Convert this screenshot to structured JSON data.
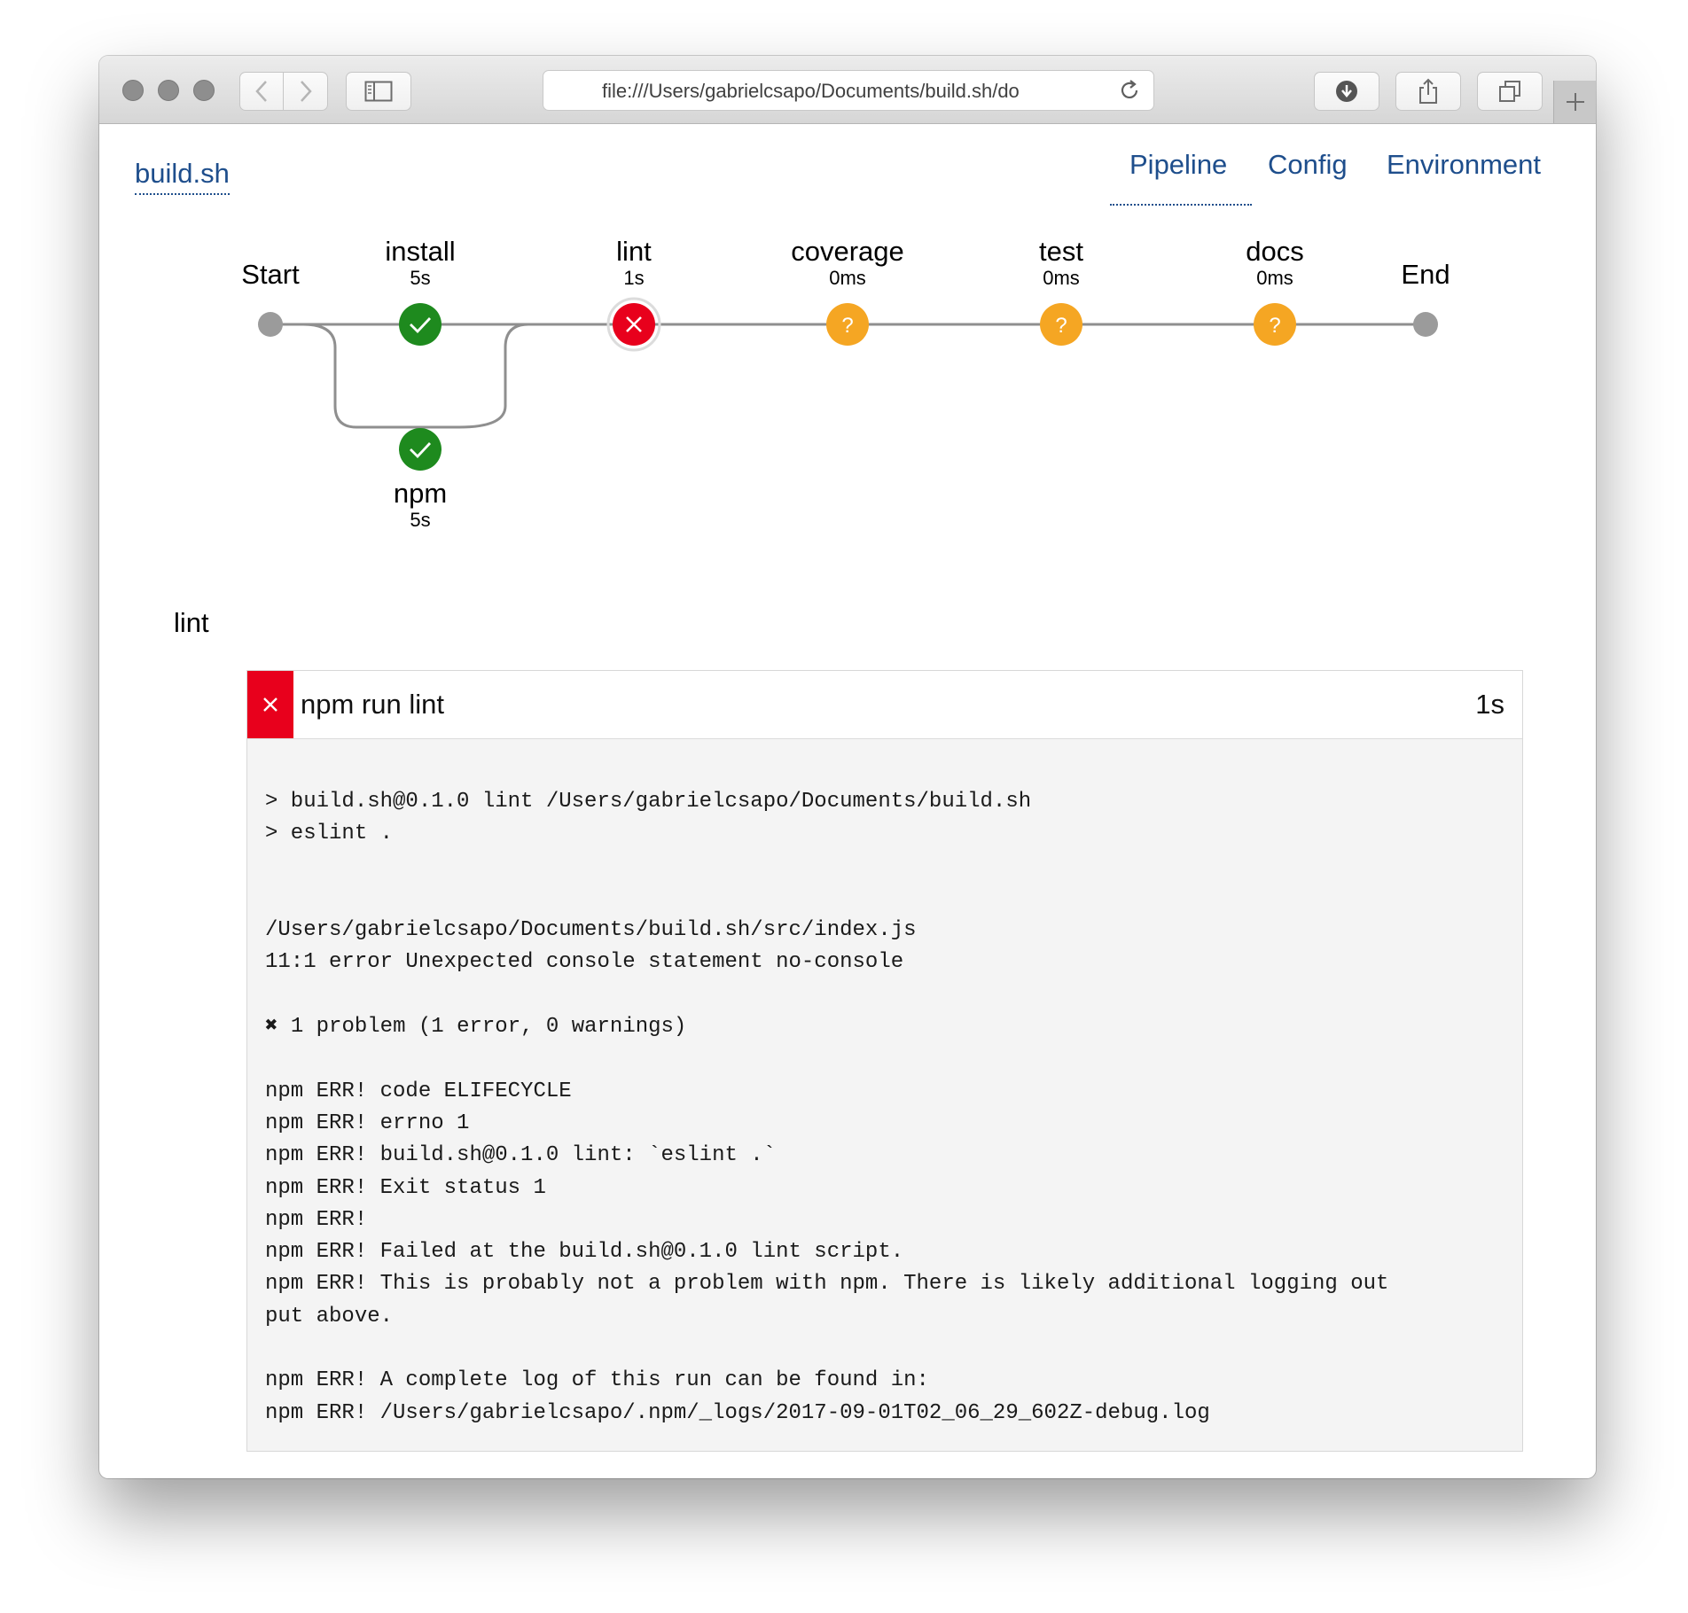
{
  "browser": {
    "url": "file:///Users/gabrielcsapo/Documents/build.sh/do"
  },
  "app": {
    "title": "build.sh",
    "nav": [
      "Pipeline",
      "Config",
      "Environment"
    ],
    "active_nav": "Pipeline"
  },
  "pipeline": {
    "start_label": "Start",
    "end_label": "End",
    "stages": [
      {
        "name": "install",
        "time": "5s",
        "status": "success"
      },
      {
        "name": "npm",
        "time": "5s",
        "status": "success"
      },
      {
        "name": "lint",
        "time": "1s",
        "status": "failed"
      },
      {
        "name": "coverage",
        "time": "0ms",
        "status": "pending"
      },
      {
        "name": "test",
        "time": "0ms",
        "status": "pending"
      },
      {
        "name": "docs",
        "time": "0ms",
        "status": "pending"
      }
    ],
    "colors": {
      "success": "#1e8a1e",
      "failed": "#e8001c",
      "pending": "#f5a623",
      "endpoint": "#9b9b9b",
      "line": "#8f8f8f"
    }
  },
  "detail": {
    "stage_title": "lint",
    "step": {
      "command": "npm run lint",
      "duration": "1s",
      "status": "failed",
      "log": "> build.sh@0.1.0 lint /Users/gabrielcsapo/Documents/build.sh\n> eslint .\n\n\n/Users/gabrielcsapo/Documents/build.sh/src/index.js\n11:1 error Unexpected console statement no-console\n\n✖ 1 problem (1 error, 0 warnings)\n\nnpm ERR! code ELIFECYCLE\nnpm ERR! errno 1\nnpm ERR! build.sh@0.1.0 lint: `eslint .`\nnpm ERR! Exit status 1\nnpm ERR!\nnpm ERR! Failed at the build.sh@0.1.0 lint script.\nnpm ERR! This is probably not a problem with npm. There is likely additional logging out\nput above.\n\nnpm ERR! A complete log of this run can be found in:\nnpm ERR! /Users/gabrielcsapo/.npm/_logs/2017-09-01T02_06_29_602Z-debug.log"
    }
  },
  "icons": {
    "back": "chevron-left-icon",
    "forward": "chevron-right-icon",
    "sidebar": "sidebar-icon",
    "reload": "reload-icon",
    "download": "download-icon",
    "share": "share-icon",
    "tabs": "tabs-icon",
    "new_tab": "plus-icon"
  }
}
